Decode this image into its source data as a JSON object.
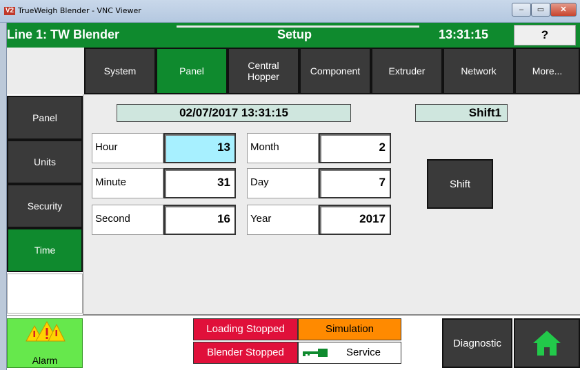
{
  "window": {
    "logo": "V2",
    "title": "TrueWeigh Blender - VNC Viewer",
    "min": "–",
    "max": "▭",
    "close": "✕"
  },
  "header": {
    "line": "Line 1: TW Blender",
    "screen": "Setup",
    "clock": "13:31:15",
    "help": "?"
  },
  "tabs": [
    {
      "label": "System"
    },
    {
      "label": "Panel"
    },
    {
      "label": "Central\nHopper"
    },
    {
      "label": "Component"
    },
    {
      "label": "Extruder"
    },
    {
      "label": "Network"
    },
    {
      "label": "More..."
    }
  ],
  "active_tab": "Panel",
  "sidebar": {
    "items": [
      {
        "label": "Panel"
      },
      {
        "label": "Units"
      },
      {
        "label": "Security"
      },
      {
        "label": "Time"
      }
    ],
    "active": "Time"
  },
  "main": {
    "datetime": "02/07/2017 13:31:15",
    "shift_display": "Shift1",
    "fields": {
      "hour": {
        "label": "Hour",
        "value": "13"
      },
      "minute": {
        "label": "Minute",
        "value": "31"
      },
      "second": {
        "label": "Second",
        "value": "16"
      },
      "month": {
        "label": "Month",
        "value": "2"
      },
      "day": {
        "label": "Day",
        "value": "7"
      },
      "year": {
        "label": "Year",
        "value": "2017"
      }
    },
    "shift_button": "Shift"
  },
  "footer": {
    "alarm": "Alarm",
    "loading": "Loading Stopped",
    "blender": "Blender Stopped",
    "simulation": "Simulation",
    "service": "Service",
    "diagnostic": "Diagnostic"
  },
  "colors": {
    "green": "#0f8a2e",
    "dark_button": "#3a3a3a",
    "selected_field": "#a7f0ff",
    "alarm_green": "#66e84c",
    "status_red": "#e0103a",
    "status_orange": "#ff8a00"
  }
}
